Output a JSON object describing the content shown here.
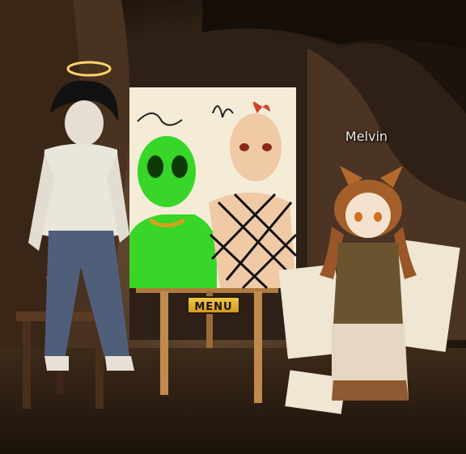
{
  "player": {
    "name": "Melvin"
  },
  "easel": {
    "menu_label": "MENU"
  },
  "colors": {
    "cave_rock": "#3a2616",
    "canvas": "#f4ecd6",
    "alien_green": "#37d629",
    "easel_wood": "#c08a4c",
    "menu_button": "#e2b036"
  }
}
